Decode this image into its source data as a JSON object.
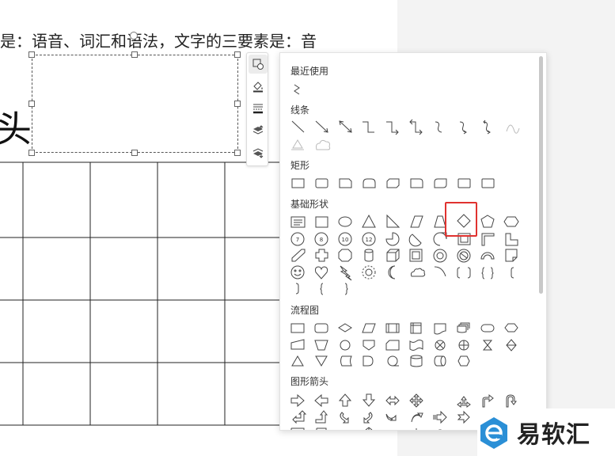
{
  "document": {
    "text_line": "是：语音、词汇和语法，文字的三要素是：音",
    "big_char": "头"
  },
  "toolbar": {
    "items": [
      {
        "icon": "shape-style-icon",
        "active": true
      },
      {
        "icon": "fill-bucket-icon"
      },
      {
        "icon": "line-style-icon"
      },
      {
        "icon": "bring-forward-icon"
      },
      {
        "icon": "send-backward-icon"
      }
    ]
  },
  "shape_panel": {
    "recent": "最近使用",
    "lines": "线条",
    "rectangles": "矩形",
    "basic": "基础形状",
    "flowchart": "流程图",
    "arrows": "图形箭头",
    "selected_shape": "diamond",
    "basic_circle_numbers": [
      "7",
      "8",
      "10",
      "12"
    ]
  },
  "watermark": {
    "text": "易软汇",
    "accent": "#2b8fd6"
  },
  "colors": {
    "highlight": "#e0322f",
    "icon_stroke": "#444444"
  }
}
